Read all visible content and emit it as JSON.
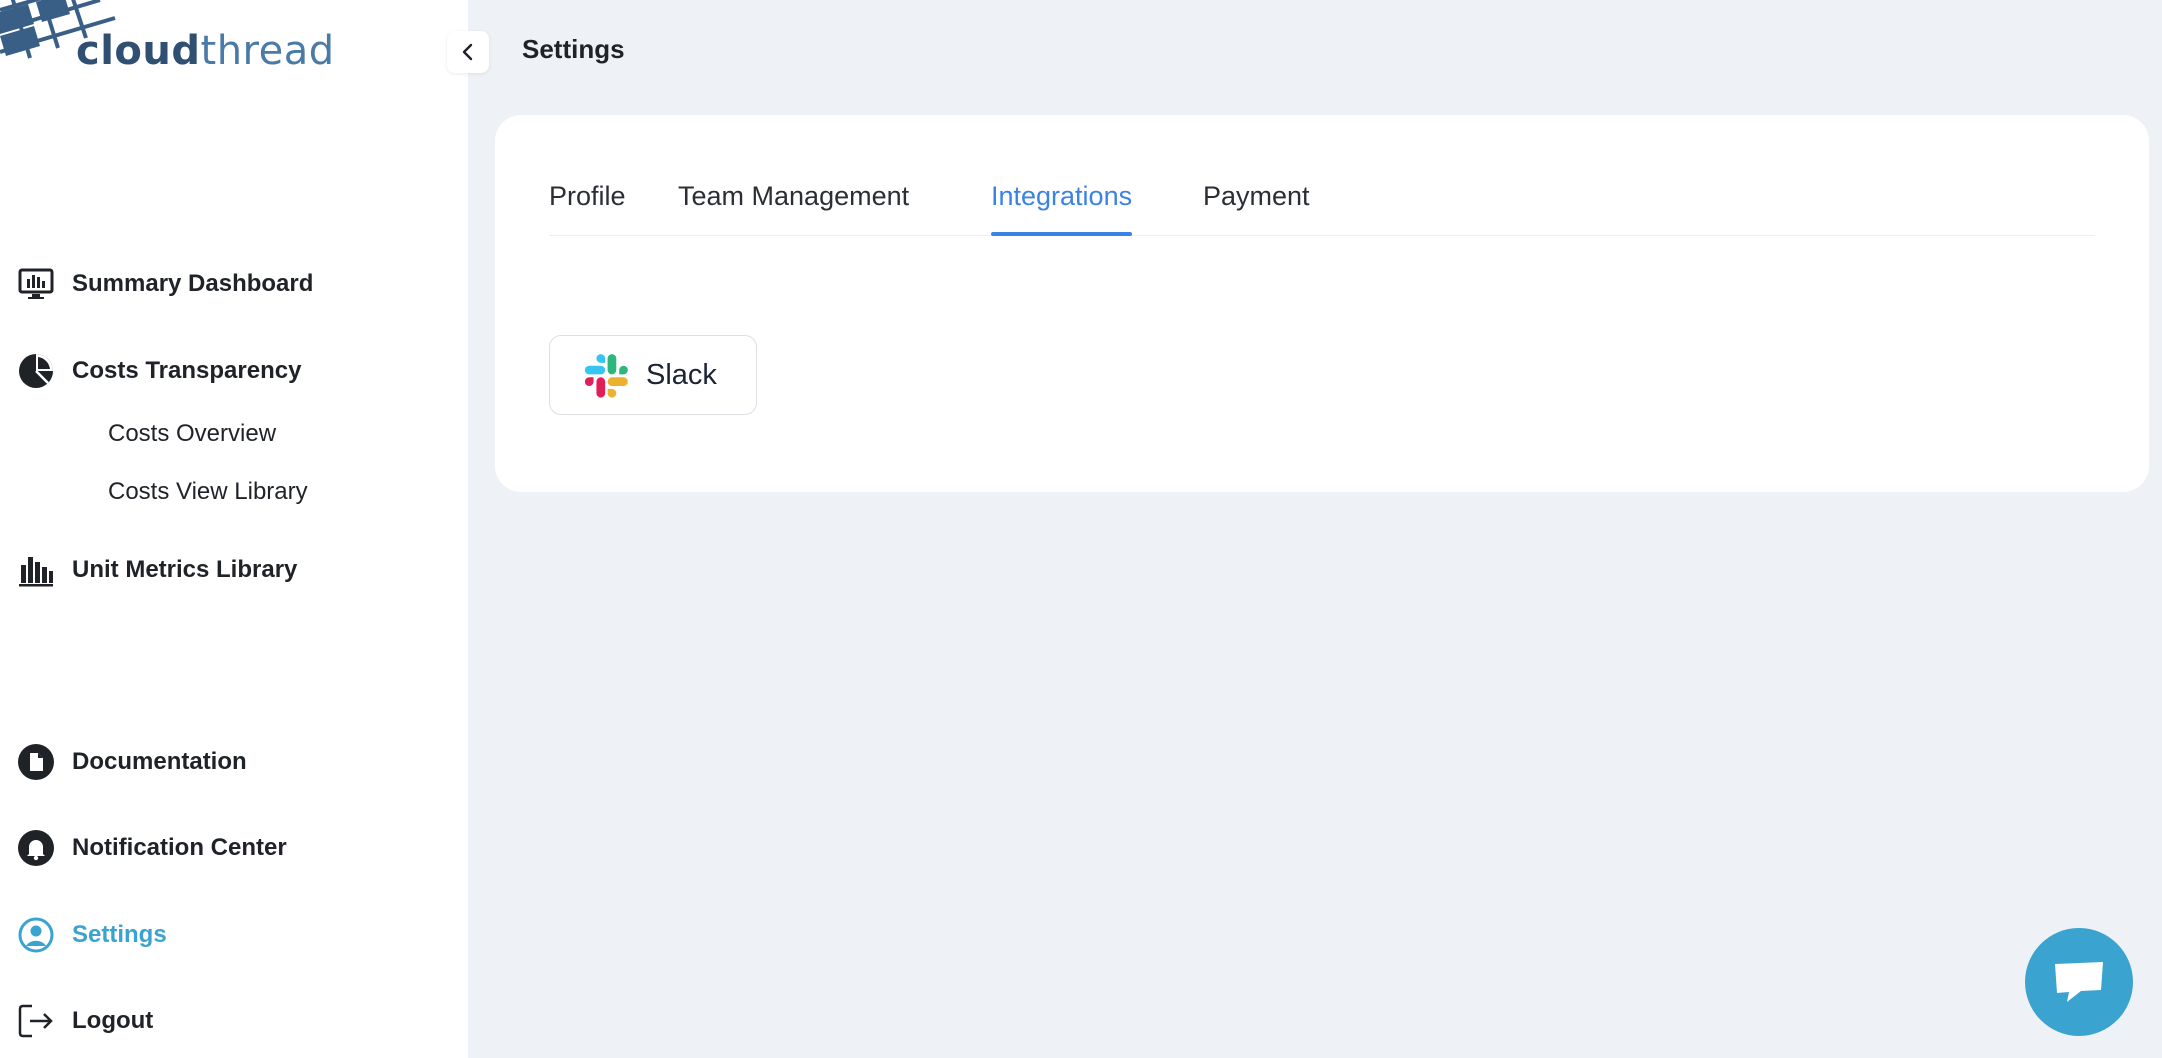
{
  "brand": {
    "name_bold": "cloud",
    "name_light": "thread"
  },
  "sidebar": {
    "items": [
      {
        "label": "Summary Dashboard",
        "icon": "monitor-chart-icon"
      },
      {
        "label": "Costs Transparency",
        "icon": "pie-chart-icon",
        "children": [
          {
            "label": "Costs Overview"
          },
          {
            "label": "Costs View Library"
          }
        ]
      },
      {
        "label": "Unit Metrics Library",
        "icon": "bar-chart-icon"
      },
      {
        "label": "Documentation",
        "icon": "document-icon"
      },
      {
        "label": "Notification Center",
        "icon": "bell-icon"
      },
      {
        "label": "Settings",
        "icon": "user-circle-icon",
        "active": true
      },
      {
        "label": "Logout",
        "icon": "logout-icon"
      }
    ]
  },
  "header": {
    "title": "Settings"
  },
  "settings": {
    "tabs": [
      {
        "label": "Profile"
      },
      {
        "label": "Team Management"
      },
      {
        "label": "Integrations",
        "active": true
      },
      {
        "label": "Payment"
      }
    ],
    "integrations": [
      {
        "label": "Slack",
        "icon": "slack-icon"
      }
    ]
  },
  "colors": {
    "accent": "#3b82e6",
    "active_nav": "#3aa3cf",
    "background": "#eef2f6",
    "brand": "#3a5f86"
  }
}
